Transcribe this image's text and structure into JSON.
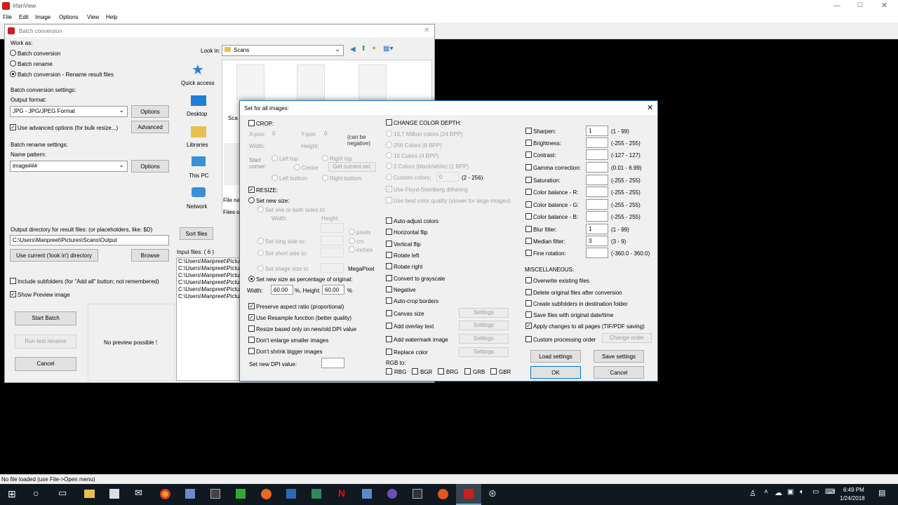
{
  "app": {
    "title": "IrfanView",
    "menu": [
      "File",
      "Edit",
      "Image",
      "Options",
      "View",
      "Help"
    ],
    "status": "No file loaded (use File->Open menu)"
  },
  "batch": {
    "title": "Batch conversion",
    "work_as": "Work as:",
    "modes": [
      "Batch conversion",
      "Batch rename",
      "Batch conversion - Rename result files"
    ],
    "conv_settings": "Batch conversion settings:",
    "output_format_label": "Output format:",
    "output_format": "JPG - JPG/JPEG Format",
    "options": "Options",
    "advanced_check": "Use advanced options (for bulk resize...)",
    "advanced": "Advanced",
    "rename_settings": "Batch rename settings:",
    "name_pattern_label": "Name pattern:",
    "name_pattern": "image###",
    "output_dir_label": "Output directory for result files: (or placeholders, like: $D)",
    "output_dir": "C:\\Users\\Manpreet\\Pictures\\Scans\\Output",
    "use_current": "Use current ('look in') directory",
    "browse": "Browse",
    "include_sub": "Include subfolders (for \"Add all\" button; not remembered)",
    "show_preview": "Show Preview image",
    "start": "Start Batch",
    "run_test": "Run test rename",
    "cancel": "Cancel",
    "no_preview": "No preview possible !",
    "look_in_label": "Look in:",
    "look_in": "Scans",
    "places": [
      "Quick access",
      "Desktop",
      "Libraries",
      "This PC",
      "Network"
    ],
    "file_name_label": "File nam",
    "files_of_label": "Files of",
    "sort": "Sort files",
    "input_files": "Input files: ( 6 )",
    "files": [
      "C:\\Users\\Manpreet\\Pictur",
      "C:\\Users\\Manpreet\\Pictur",
      "C:\\Users\\Manpreet\\Pictur",
      "C:\\Users\\Manpreet\\Pictur",
      "C:\\Users\\Manpreet\\Pictur",
      "C:\\Users\\Manpreet\\Pictur"
    ],
    "scan_label": "Sca"
  },
  "dlg": {
    "title": "Set for all images:",
    "crop": "CROP:",
    "xpos": "X-pos:",
    "xpos_val": "0",
    "ypos": "Y-pos:",
    "ypos_val": "0",
    "can_neg": "(can be negative)",
    "width": "Width:",
    "height": "Height:",
    "start_corner": "Start corner:",
    "corners": [
      "Left top",
      "Right top",
      "Center",
      "Left bottom",
      "Right bottom"
    ],
    "get_sel": "Get current sel.",
    "resize": "RESIZE:",
    "set_new_size": "Set new size:",
    "one_or_both": "Set one or both sides to:",
    "rs_width": "Width:",
    "rs_height": "Height:",
    "units": [
      "pixels",
      "cm",
      "inches"
    ],
    "long_side": "Set long side to:",
    "short_side": "Set short side to:",
    "image_size": "Set image size to",
    "megapixel": "MegaPixel",
    "pct": "Set new size as percentage of original:",
    "pct_w_label": "Width:",
    "pct_w": "60.00",
    "pct_h_label": "%, Height:",
    "pct_h": "60.00",
    "pct_sign": "%",
    "left_checks": [
      "Preserve aspect ratio (proportional)",
      "Use Resample function (better quality)",
      "Resize based only on new/old DPI value",
      "Don't enlarge smaller images",
      "Don't shrink bigger images"
    ],
    "dpi_label": "Set new DPI value:",
    "color_depth": "CHANGE COLOR DEPTH:",
    "depths": [
      "16,7 Million colors (24 BPP)",
      "256 Colors (8 BPP)",
      "16 Colors (4 BPP)",
      "2 Colors (black/white) (1 BPP)",
      "Custom colors:"
    ],
    "custom_val": "0",
    "custom_range": "(2 - 256)",
    "floyd": "Use Floyd-Steinberg dithering",
    "best_color": "Use best color quality (slower for large images)",
    "mid_checks": [
      "Auto-adjust colors",
      "Horizontal flip",
      "Vertical flip",
      "Rotate left",
      "Rotate right",
      "Convert to grayscale",
      "Negative",
      "Auto-crop borders"
    ],
    "mid_settings": [
      "Canvas size",
      "Add overlay text",
      "Add watermark image",
      "Replace color"
    ],
    "settings": "Settings",
    "rgb_label": "RGB to:",
    "rgb": [
      "RBG",
      "BGR",
      "BRG",
      "GRB",
      "GBR"
    ],
    "right_rows": [
      {
        "l": "Sharpen:",
        "v": "1",
        "r": "(1 - 99)"
      },
      {
        "l": "Brightness:",
        "v": "",
        "r": "(-255 - 255)"
      },
      {
        "l": "Contrast:",
        "v": "",
        "r": "(-127 - 127)"
      },
      {
        "l": "Gamma correction:",
        "v": "",
        "r": "(0.01 - 6.99)"
      },
      {
        "l": "Saturation:",
        "v": "",
        "r": "(-255 - 255)"
      },
      {
        "l": "Color balance - R:",
        "v": "",
        "r": "(-255 - 255)"
      },
      {
        "l": "Color balance - G:",
        "v": "",
        "r": "(-255 - 255)"
      },
      {
        "l": "Color balance - B:",
        "v": "",
        "r": "(-255 - 255)"
      },
      {
        "l": "Blur filter:",
        "v": "1",
        "r": "(1 - 99)"
      },
      {
        "l": "Median filter:",
        "v": "3",
        "r": "(3 - 9)"
      },
      {
        "l": "Fine rotation:",
        "v": "",
        "r": "(-360.0 - 360.0)"
      }
    ],
    "misc": "MISCELLANEOUS:",
    "misc_checks": [
      "Overwrite existing files",
      "Delete original files after conversion",
      "Create subfolders in destination folder",
      "Save files with original date/time",
      "Apply changes to all pages (TIF/PDF saving)",
      "Custom processing order"
    ],
    "change_order": "Change order",
    "load": "Load settings",
    "save": "Save settings",
    "ok": "OK",
    "cancel": "Cancel"
  },
  "taskbar": {
    "time": "6:49 PM",
    "date": "1/24/2018"
  }
}
